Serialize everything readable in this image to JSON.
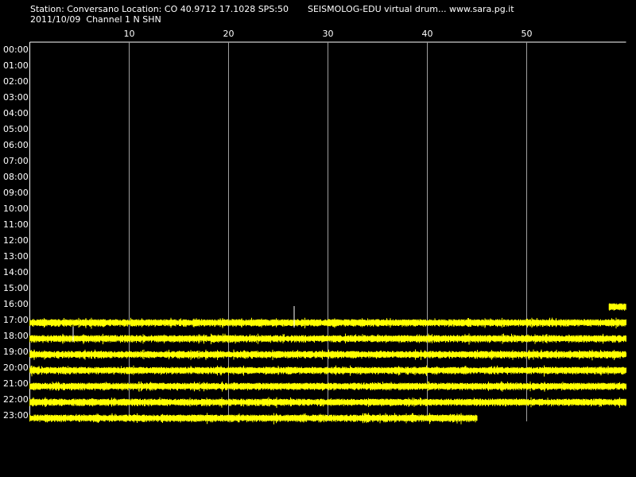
{
  "header": {
    "station_line": "Station: Conversano Location: CO 40.9712 17.1028 SPS:50",
    "date_line": "2011/10/09  Channel 1 N SHN",
    "app_line": "SEISMOLOG-EDU virtual drum... www.sara.pg.it"
  },
  "hours": [
    "00:00",
    "01:00",
    "02:00",
    "03:00",
    "04:00",
    "05:00",
    "06:00",
    "07:00",
    "08:00",
    "09:00",
    "10:00",
    "11:00",
    "12:00",
    "13:00",
    "14:00",
    "15:00",
    "16:00",
    "17:00",
    "18:00",
    "19:00",
    "20:00",
    "21:00",
    "22:00",
    "23:00"
  ],
  "minute_ticks": [
    "10",
    "20",
    "30",
    "40",
    "50"
  ],
  "colors": {
    "background": "#000000",
    "trace": "#ffff00",
    "grid": "#a0a0a0",
    "text": "#ffffff"
  },
  "traces": [
    {
      "hour": "16:00",
      "start_min": 58.3,
      "end_min": 60
    },
    {
      "hour": "17:00",
      "start_min": 0,
      "end_min": 60
    },
    {
      "hour": "18:00",
      "start_min": 0,
      "end_min": 60
    },
    {
      "hour": "19:00",
      "start_min": 0,
      "end_min": 60
    },
    {
      "hour": "20:00",
      "start_min": 0,
      "end_min": 60
    },
    {
      "hour": "21:00",
      "start_min": 0,
      "end_min": 60
    },
    {
      "hour": "22:00",
      "start_min": 0,
      "end_min": 60
    },
    {
      "hour": "23:00",
      "start_min": 0,
      "end_min": 45
    }
  ]
}
